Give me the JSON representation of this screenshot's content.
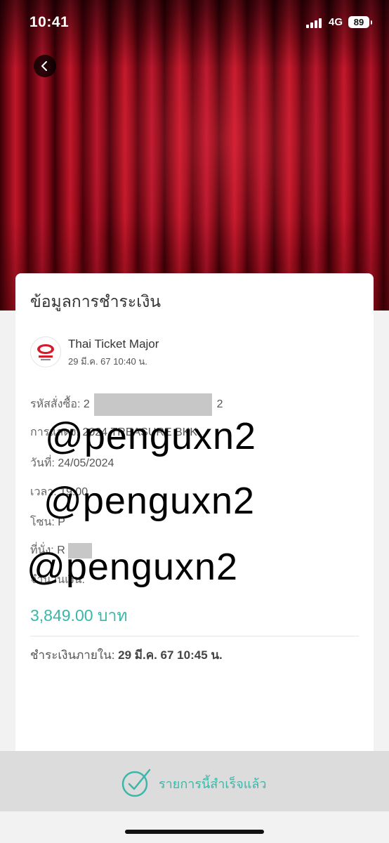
{
  "status_bar": {
    "time": "10:41",
    "network": "4G",
    "battery": "89"
  },
  "header": {
    "back_icon": "chevron-left-icon"
  },
  "card": {
    "title": "ข้อมูลการชำระเงิน",
    "merchant": {
      "name": "Thai Ticket Major",
      "datetime": "29 มี.ค. 67  10:40 น."
    },
    "order_label": "รหัสสั่งซื้อ:",
    "order_prefix": "2",
    "order_suffix": "2",
    "show_label": "การแสดง:",
    "show_value": "2024 TREASURE BKK",
    "date_label": "วันที่:",
    "date_value": "24/05/2024",
    "time_label": "เวลา:",
    "time_value": "19:00",
    "zone_label": "โซน:",
    "zone_value": "P",
    "seat_label": "ที่นั่ง:",
    "seat_value": "R",
    "amount_label": "จำนวนเงิน:",
    "amount_value": "3,849.00 บาท",
    "pay_by_label": "ชำระเงินภายใน:",
    "pay_by_value": "29 มี.ค. 67  10:45 น."
  },
  "watermark": {
    "line1": "@penguxn2",
    "line2": "@penguxn2",
    "line3": "@penguxn2"
  },
  "footer": {
    "status_text": "รายการนี้สำเร็จแล้ว",
    "icon": "check-circle-icon"
  },
  "colors": {
    "accent": "#3bb7a9",
    "curtain": "#b3132a"
  }
}
